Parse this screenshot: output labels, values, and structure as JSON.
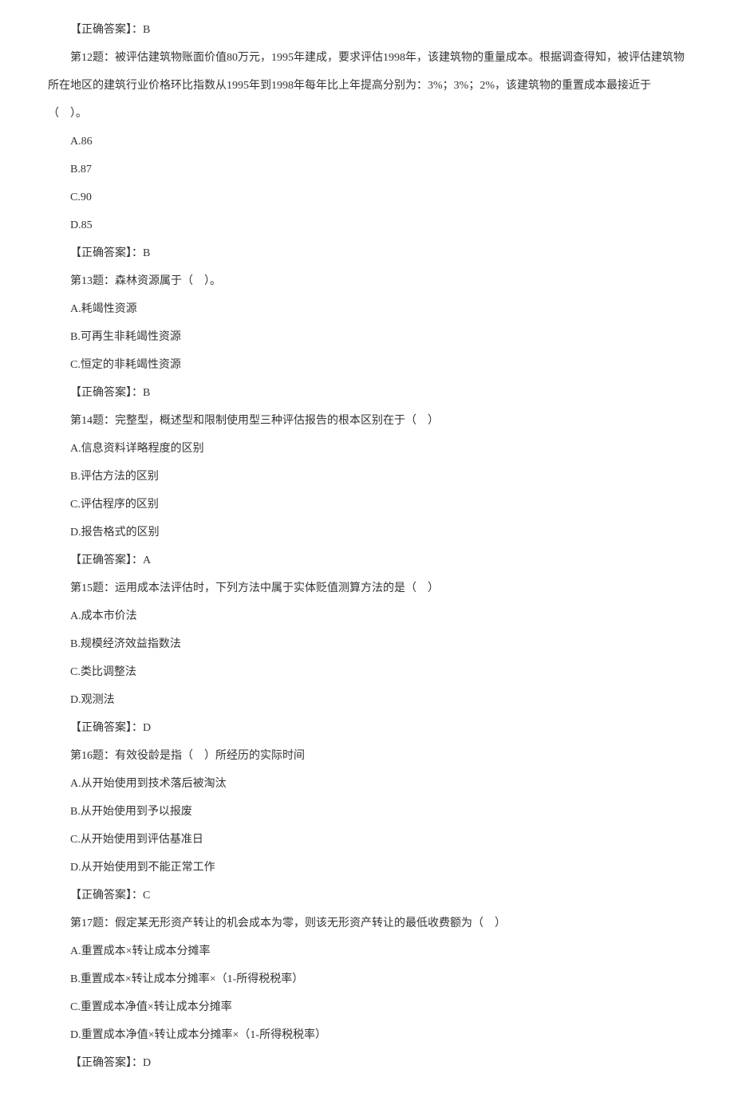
{
  "lines": [
    {
      "text": "【正确答案】：B",
      "indent": true
    },
    {
      "text": "第12题：被评估建筑物账面价值80万元，1995年建成，要求评估1998年，该建筑物的重量成本。根据调查得知，被评估建筑物所在地区的建筑行业价格环比指数从1995年到1998年每年比上年提高分别为：3%；3%；2%，该建筑物的重置成本最接近于（　）。",
      "indent": true,
      "longtext": true
    },
    {
      "text": "A.86",
      "indent": true
    },
    {
      "text": "B.87",
      "indent": true
    },
    {
      "text": "C.90",
      "indent": true
    },
    {
      "text": "D.85",
      "indent": true
    },
    {
      "text": "【正确答案】：B",
      "indent": true
    },
    {
      "text": "第13题：森林资源属于（　）。",
      "indent": true
    },
    {
      "text": "A.耗竭性资源",
      "indent": true
    },
    {
      "text": "B.可再生非耗竭性资源",
      "indent": true
    },
    {
      "text": "C.恒定的非耗竭性资源",
      "indent": true
    },
    {
      "text": "【正确答案】：B",
      "indent": true
    },
    {
      "text": "第14题：完整型，概述型和限制使用型三种评估报告的根本区别在于（　）",
      "indent": true
    },
    {
      "text": "A.信息资料详略程度的区别",
      "indent": true
    },
    {
      "text": "B.评估方法的区别",
      "indent": true
    },
    {
      "text": "C.评估程序的区别",
      "indent": true
    },
    {
      "text": "D.报告格式的区别",
      "indent": true
    },
    {
      "text": "【正确答案】：A",
      "indent": true
    },
    {
      "text": "第15题：运用成本法评估时，下列方法中属于实体贬值测算方法的是（　）",
      "indent": true
    },
    {
      "text": "A.成本市价法",
      "indent": true
    },
    {
      "text": "B.规模经济效益指数法",
      "indent": true
    },
    {
      "text": "C.类比调整法",
      "indent": true
    },
    {
      "text": "D.观测法",
      "indent": true
    },
    {
      "text": "【正确答案】：D",
      "indent": true
    },
    {
      "text": "第16题：有效役龄是指（　）所经历的实际时间",
      "indent": true
    },
    {
      "text": "A.从开始使用到技术落后被淘汰",
      "indent": true
    },
    {
      "text": "B.从开始使用到予以报废",
      "indent": true
    },
    {
      "text": "C.从开始使用到评估基准日",
      "indent": true
    },
    {
      "text": "D.从开始使用到不能正常工作",
      "indent": true
    },
    {
      "text": "【正确答案】：C",
      "indent": true
    },
    {
      "text": "第17题：假定某无形资产转让的机会成本为零，则该无形资产转让的最低收费额为（　）",
      "indent": true
    },
    {
      "text": "A.重置成本×转让成本分摊率",
      "indent": true
    },
    {
      "text": "B.重置成本×转让成本分摊率×（1-所得税税率）",
      "indent": true
    },
    {
      "text": "C.重置成本净值×转让成本分摊率",
      "indent": true
    },
    {
      "text": "D.重置成本净值×转让成本分摊率×（1-所得税税率）",
      "indent": true
    },
    {
      "text": "【正确答案】：D",
      "indent": true
    }
  ]
}
